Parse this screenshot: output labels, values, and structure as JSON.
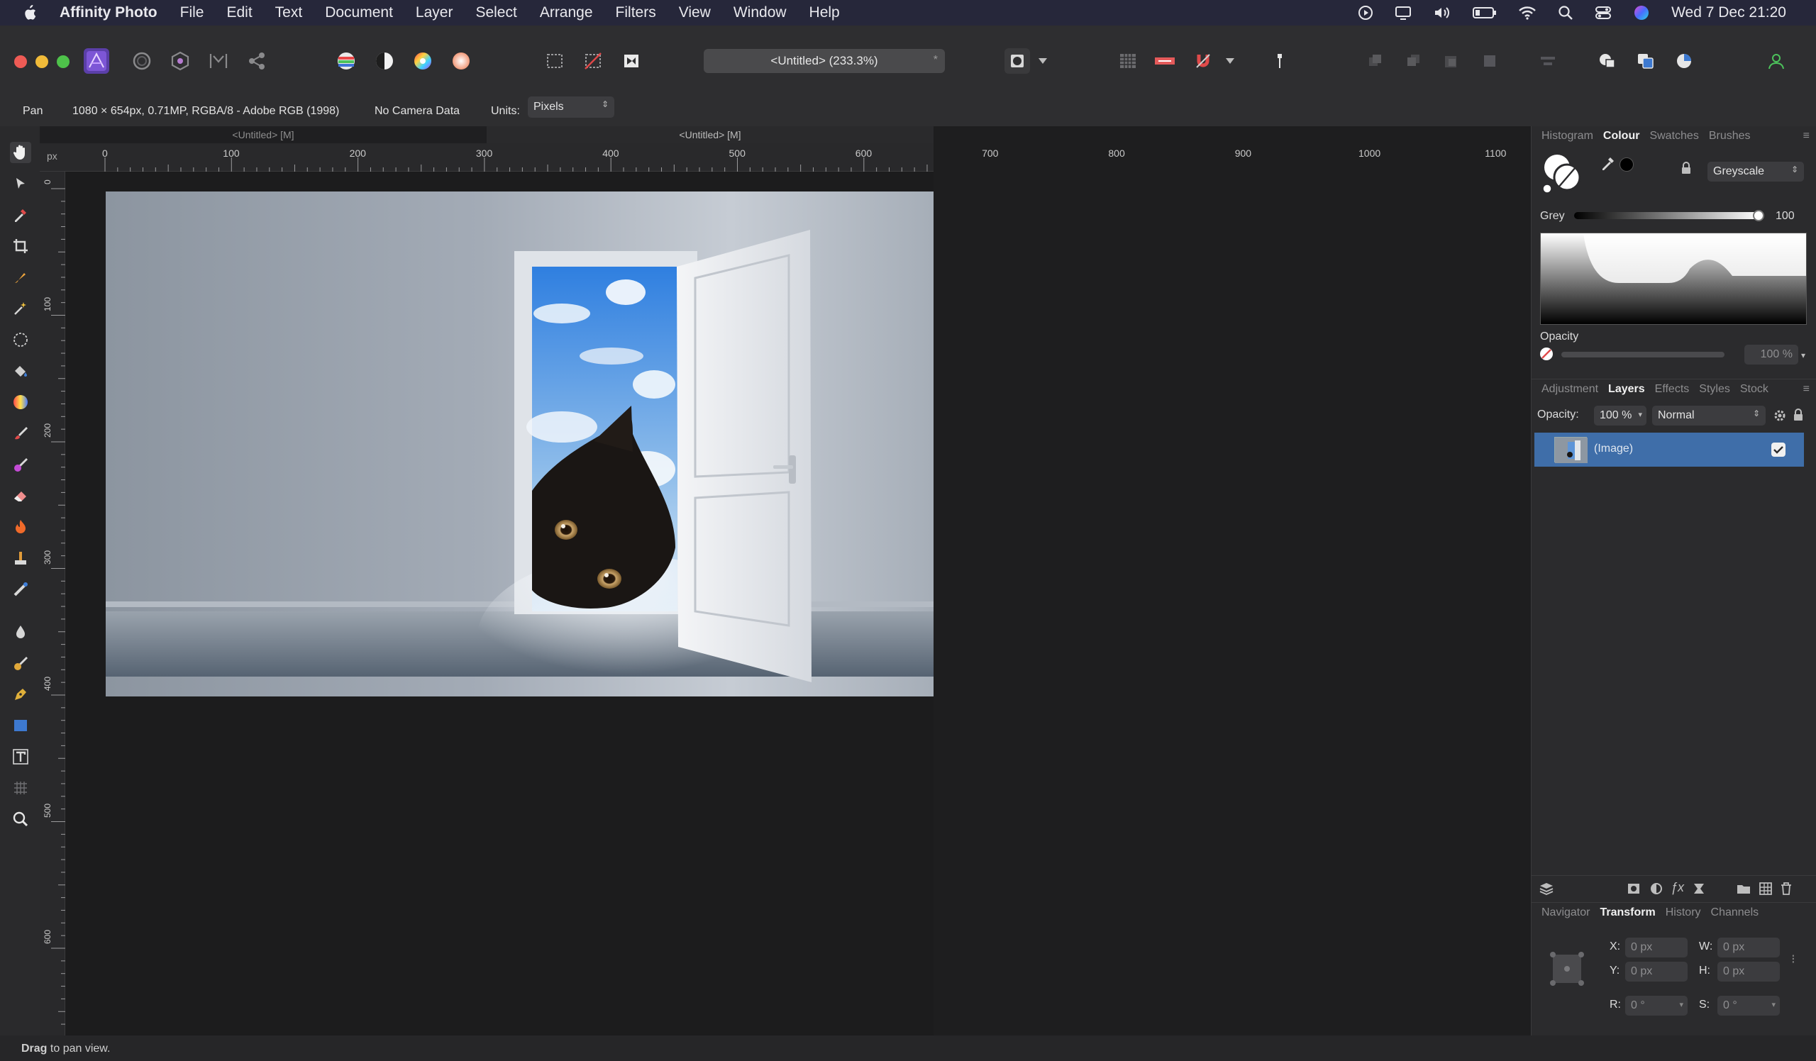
{
  "menubar": {
    "app_name": "Affinity Photo",
    "items": [
      "File",
      "Edit",
      "Text",
      "Document",
      "Layer",
      "Select",
      "Arrange",
      "Filters",
      "View",
      "Window",
      "Help"
    ],
    "datetime": "Wed 7 Dec  21:20"
  },
  "toolbar": {
    "document_title": "<Untitled> (233.3%)",
    "dirty_marker": "*"
  },
  "contextbar": {
    "tool_name": "Pan",
    "image_info": "1080 × 654px, 0.71MP, RGBA/8 - Adobe RGB (1998)",
    "camera": "No Camera Data",
    "units_label": "Units:",
    "units_value": "Pixels"
  },
  "doc_tabs": [
    "<Untitled> [M]",
    "<Untitled> [M]"
  ],
  "ruler": {
    "unit": "px",
    "top_ticks": [
      "0",
      "100",
      "200",
      "300",
      "400",
      "500",
      "600",
      "700",
      "800",
      "900",
      "1000",
      "1100"
    ],
    "left_ticks": [
      "0",
      "100",
      "200",
      "300",
      "400",
      "500",
      "600"
    ]
  },
  "colour_panel": {
    "tabs": [
      "Histogram",
      "Colour",
      "Swatches",
      "Brushes"
    ],
    "active_tab": "Colour",
    "mode": "Greyscale",
    "grey_label": "Grey",
    "grey_value": "100",
    "opacity_label": "Opacity",
    "opacity_value": "100 %"
  },
  "layers_panel": {
    "tabs": [
      "Adjustment",
      "Layers",
      "Effects",
      "Styles",
      "Stock"
    ],
    "active_tab": "Layers",
    "opacity_label": "Opacity:",
    "opacity_value": "100 %",
    "blend_mode": "Normal",
    "layers": [
      {
        "name": "(Image)",
        "visible": true
      }
    ]
  },
  "transform_panel": {
    "tabs": [
      "Navigator",
      "Transform",
      "History",
      "Channels"
    ],
    "active_tab": "Transform",
    "x_label": "X:",
    "x_value": "0 px",
    "y_label": "Y:",
    "y_value": "0 px",
    "w_label": "W:",
    "w_value": "0 px",
    "h_label": "H:",
    "h_value": "0 px",
    "r_label": "R:",
    "r_value": "0 °",
    "s_label": "S:",
    "s_value": "0 °"
  },
  "statusbar": {
    "bold": "Drag",
    "rest": " to pan view."
  },
  "colors": {
    "accent": "#3d6fb5",
    "layer_selected": "#3f6ea9"
  }
}
